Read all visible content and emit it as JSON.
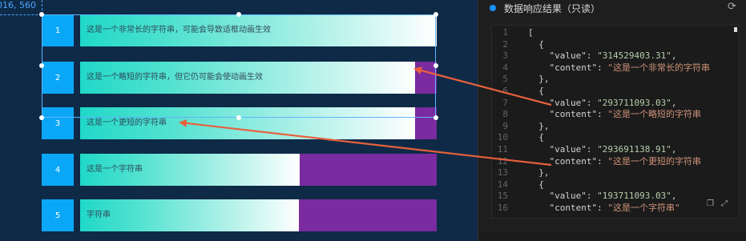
{
  "canvas": {
    "coord_label": "016, 560",
    "rows": [
      {
        "index": "1",
        "text": "这是一个非常长的字符串，可能会导致适框动画生效",
        "fill_ratio": 1.0
      },
      {
        "index": "2",
        "text": "这是一个略短的字符串，但它仍可能会使动画生效",
        "fill_ratio": 0.94
      },
      {
        "index": "3",
        "text": "这是一个更短的字符串",
        "fill_ratio": 0.94
      },
      {
        "index": "4",
        "text": "这是一个字符串",
        "fill_ratio": 0.616
      },
      {
        "index": "5",
        "text": "字符串",
        "fill_ratio": 0.614
      }
    ]
  },
  "panel": {
    "title": "数据响应结果（只读）",
    "refresh_icon": "refresh-icon",
    "copy_icon": "copy-icon",
    "expand_icon": "expand-icon",
    "lines": [
      {
        "n": "1",
        "code": "["
      },
      {
        "n": "2",
        "code": "  {"
      },
      {
        "n": "3",
        "key": "    \"value\": ",
        "val": "\"314529403.31\"",
        "tail": ","
      },
      {
        "n": "4",
        "key": "    \"content\": ",
        "str": "\"这是一个非常长的字符串"
      },
      {
        "n": "5",
        "code": "  },"
      },
      {
        "n": "6",
        "code": "  {"
      },
      {
        "n": "7",
        "key": "    \"value\": ",
        "val": "\"293711093.03\"",
        "tail": ","
      },
      {
        "n": "8",
        "key": "    \"content\": ",
        "str": "\"这是一个略短的字符串"
      },
      {
        "n": "9",
        "code": "  },"
      },
      {
        "n": "10",
        "code": "  {"
      },
      {
        "n": "11",
        "key": "    \"value\": ",
        "val": "\"293691138.91\"",
        "tail": ","
      },
      {
        "n": "12",
        "key": "    \"content\": ",
        "str": "\"这是一个更短的字符串"
      },
      {
        "n": "13",
        "code": "  },"
      },
      {
        "n": "14",
        "code": "  {"
      },
      {
        "n": "15",
        "key": "    \"value\": ",
        "val": "\"193711093.03\"",
        "tail": ","
      },
      {
        "n": "16",
        "key": "    \"content\": ",
        "str": "\"这是一个字符串\""
      }
    ]
  },
  "colors": {
    "index_bg": "#0ba7f7",
    "bar_bg": "#7a2b9f",
    "arrow": "#e8603c",
    "accent": "#1890ff"
  }
}
